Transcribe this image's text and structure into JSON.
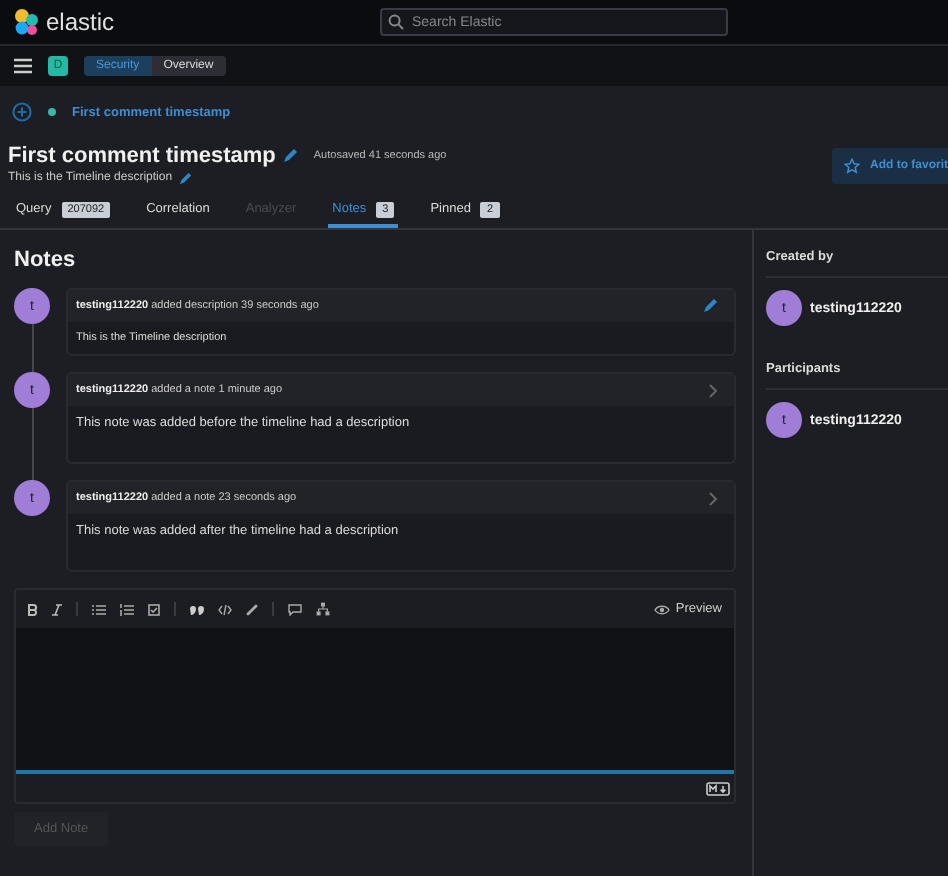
{
  "header": {
    "logo_text": "elastic",
    "search": {
      "placeholder": "Search Elastic"
    }
  },
  "nav": {
    "space_badge": "D",
    "breadcrumbs": [
      {
        "label": "Security",
        "selected": false
      },
      {
        "label": "Overview",
        "selected": true
      }
    ]
  },
  "timeline_tab": {
    "label": "First comment timestamp"
  },
  "title": {
    "text": "First comment timestamp",
    "autosave": "Autosaved 41 seconds ago",
    "description": "This is the Timeline description",
    "favorite_button": "Add to favorit"
  },
  "tabs": [
    {
      "label": "Query",
      "count": "207092",
      "selected": false,
      "disabled": false
    },
    {
      "label": "Correlation",
      "selected": false,
      "disabled": false
    },
    {
      "label": "Analyzer",
      "selected": false,
      "disabled": true
    },
    {
      "label": "Notes",
      "count": "3",
      "selected": true,
      "disabled": false
    },
    {
      "label": "Pinned",
      "count": "2",
      "selected": false,
      "disabled": false
    }
  ],
  "notes_heading": "Notes",
  "notes": [
    {
      "kind": "description",
      "avatar": "t",
      "user": "testing112220",
      "action": "added description 39 seconds ago",
      "text": "This is the Timeline description"
    },
    {
      "kind": "note",
      "avatar": "t",
      "user": "testing112220",
      "action": "added a note 1 minute ago",
      "text": "This note was added before the timeline had a description"
    },
    {
      "kind": "note",
      "avatar": "t",
      "user": "testing112220",
      "action": "added a note 23 seconds ago",
      "text": "This note was added after the timeline had a description"
    }
  ],
  "editor": {
    "preview_button": "Preview",
    "add_button": "Add Note",
    "add_disabled": true
  },
  "sidebar": {
    "created_by": {
      "heading": "Created by",
      "users": [
        {
          "avatar": "t",
          "name": "testing112220"
        }
      ]
    },
    "participants": {
      "heading": "Participants",
      "users": [
        {
          "avatar": "t",
          "name": "testing112220"
        }
      ]
    }
  }
}
